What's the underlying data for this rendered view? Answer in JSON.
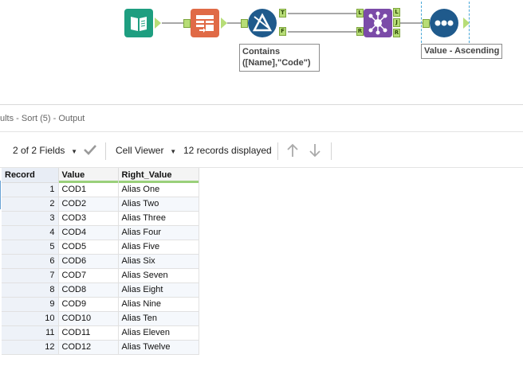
{
  "workflow": {
    "tools": [
      {
        "id": "input",
        "icon": "book-input-icon",
        "color": "#1e9e80"
      },
      {
        "id": "select",
        "icon": "select-tool-icon",
        "color": "#e06a46"
      },
      {
        "id": "filter",
        "icon": "filter-triangle-icon",
        "color": "#1f5a8c"
      },
      {
        "id": "join",
        "icon": "join-network-icon",
        "color": "#7b4ba8"
      },
      {
        "id": "sort",
        "icon": "sort-dots-icon",
        "color": "#1f5a8c"
      }
    ],
    "filter_anchor_true": "T",
    "filter_anchor_false": "F",
    "join_anchor_left": "L",
    "join_anchor_right": "R",
    "join_out_l": "L",
    "join_out_j": "J",
    "join_out_r": "R",
    "filter_annotation": "Contains\n([Name],\"Code\")",
    "sort_annotation": "Value - Ascending"
  },
  "results": {
    "header_title": "ults - Sort (5) - Output",
    "fields_label": "2 of 2 Fields",
    "viewer_label": "Cell Viewer",
    "records_label": "12 records displayed",
    "columns": [
      "Record",
      "Value",
      "Right_Value"
    ],
    "rows": [
      {
        "record": "1",
        "value": "COD1",
        "right_value": "Alias One"
      },
      {
        "record": "2",
        "value": "COD2",
        "right_value": "Alias Two"
      },
      {
        "record": "3",
        "value": "COD3",
        "right_value": "Alias Three"
      },
      {
        "record": "4",
        "value": "COD4",
        "right_value": "Alias Four"
      },
      {
        "record": "5",
        "value": "COD5",
        "right_value": "Alias Five"
      },
      {
        "record": "6",
        "value": "COD6",
        "right_value": "Alias Six"
      },
      {
        "record": "7",
        "value": "COD7",
        "right_value": "Alias Seven"
      },
      {
        "record": "8",
        "value": "COD8",
        "right_value": "Alias Eight"
      },
      {
        "record": "9",
        "value": "COD9",
        "right_value": "Alias Nine"
      },
      {
        "record": "10",
        "value": "COD10",
        "right_value": "Alias Ten"
      },
      {
        "record": "11",
        "value": "COD11",
        "right_value": "Alias Eleven"
      },
      {
        "record": "12",
        "value": "COD12",
        "right_value": "Alias Twelve"
      }
    ]
  }
}
